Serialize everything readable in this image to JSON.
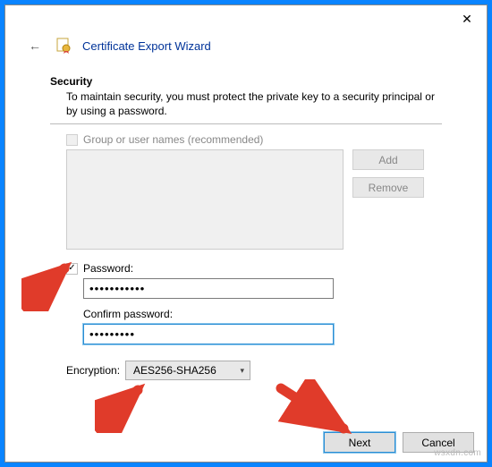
{
  "window": {
    "title": "Certificate Export Wizard"
  },
  "security": {
    "heading": "Security",
    "description": "To maintain security, you must protect the private key to a security principal or by using a password.",
    "group_label": "Group or user names (recommended)",
    "add_label": "Add",
    "remove_label": "Remove"
  },
  "password": {
    "label": "Password:",
    "value": "•••••••••••",
    "confirm_label": "Confirm password:",
    "confirm_value": "•••••••••"
  },
  "encryption": {
    "label": "Encryption:",
    "selected": "AES256-SHA256"
  },
  "footer": {
    "next": "Next",
    "cancel": "Cancel"
  },
  "watermark": "wsxdn.com",
  "colors": {
    "accent": "#003399",
    "frame_blue": "#0a84ff",
    "arrow_red": "#e03b2a"
  }
}
